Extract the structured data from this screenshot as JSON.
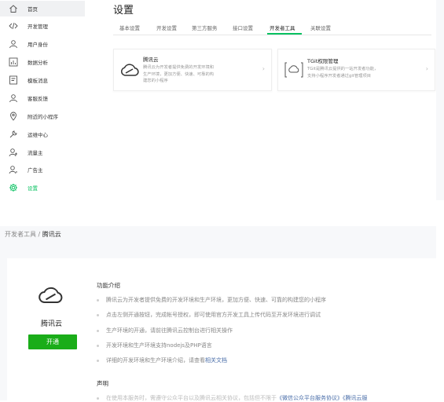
{
  "sidebar": {
    "items": [
      {
        "label": "首页",
        "icon": "home-icon"
      },
      {
        "label": "开发管理",
        "icon": "code-icon"
      },
      {
        "label": "用户身份",
        "icon": "user-icon"
      },
      {
        "label": "数据分析",
        "icon": "chart-icon"
      },
      {
        "label": "模板消息",
        "icon": "template-icon"
      },
      {
        "label": "客服反馈",
        "icon": "feedback-icon"
      },
      {
        "label": "附近的小程序",
        "icon": "location-icon"
      },
      {
        "label": "运维中心",
        "icon": "wrench-icon"
      },
      {
        "label": "流量主",
        "icon": "traffic-icon"
      },
      {
        "label": "广告主",
        "icon": "advertiser-icon"
      },
      {
        "label": "设置",
        "icon": "gear-icon"
      }
    ]
  },
  "header": {
    "title": "设置"
  },
  "tabs": [
    "基本设置",
    "开发设置",
    "第三方服务",
    "接口设置",
    "开发者工具",
    "关联设置"
  ],
  "active_tab": "开发者工具",
  "cards": [
    {
      "title": "腾讯云",
      "desc": [
        "腾讯云为开发者提供免费的开发环境和",
        "生产环境，更加方便、快速、可靠的构",
        "建您的小程序"
      ]
    },
    {
      "title": "TGit权限管理",
      "desc": [
        "TGit是腾讯云提供的一站开发者功能，",
        "支持小程序开发者通过git管理项目"
      ]
    }
  ],
  "detail": {
    "breadcrumb_parent": "开发者工具",
    "breadcrumb_sep": "/",
    "breadcrumb_current": "腾讯云",
    "service_name": "腾讯云",
    "open_button": "开通",
    "features_title": "功能介绍",
    "features": [
      "腾讯云为开发者提供免费的开发环境和生产环境，更加方便、快速、可靠的构建您的小程序",
      "点击左侧开通按钮，完成帐号授权，即可使用官方开发工具上传代码至开发环境进行调试",
      "生产环境的开通，请前往腾讯云控制台进行相关操作",
      "开发环境和生产环境支持nodejs及PHP语言"
    ],
    "last_feature_text": "详细的开发环境和生产环境介绍，请查看",
    "last_feature_link": "相关文档",
    "statement_title": "声明",
    "statement_line": "在使用本服务时，需遵守公众平台以及腾讯云相关协议，包括但不限于",
    "statement_link1": "《微信公众平台服务协议》",
    "statement_link2": "《腾讯云服"
  },
  "colors": {
    "accent": "#07c160",
    "button": "#1aad19",
    "link": "#4a6ea9"
  }
}
